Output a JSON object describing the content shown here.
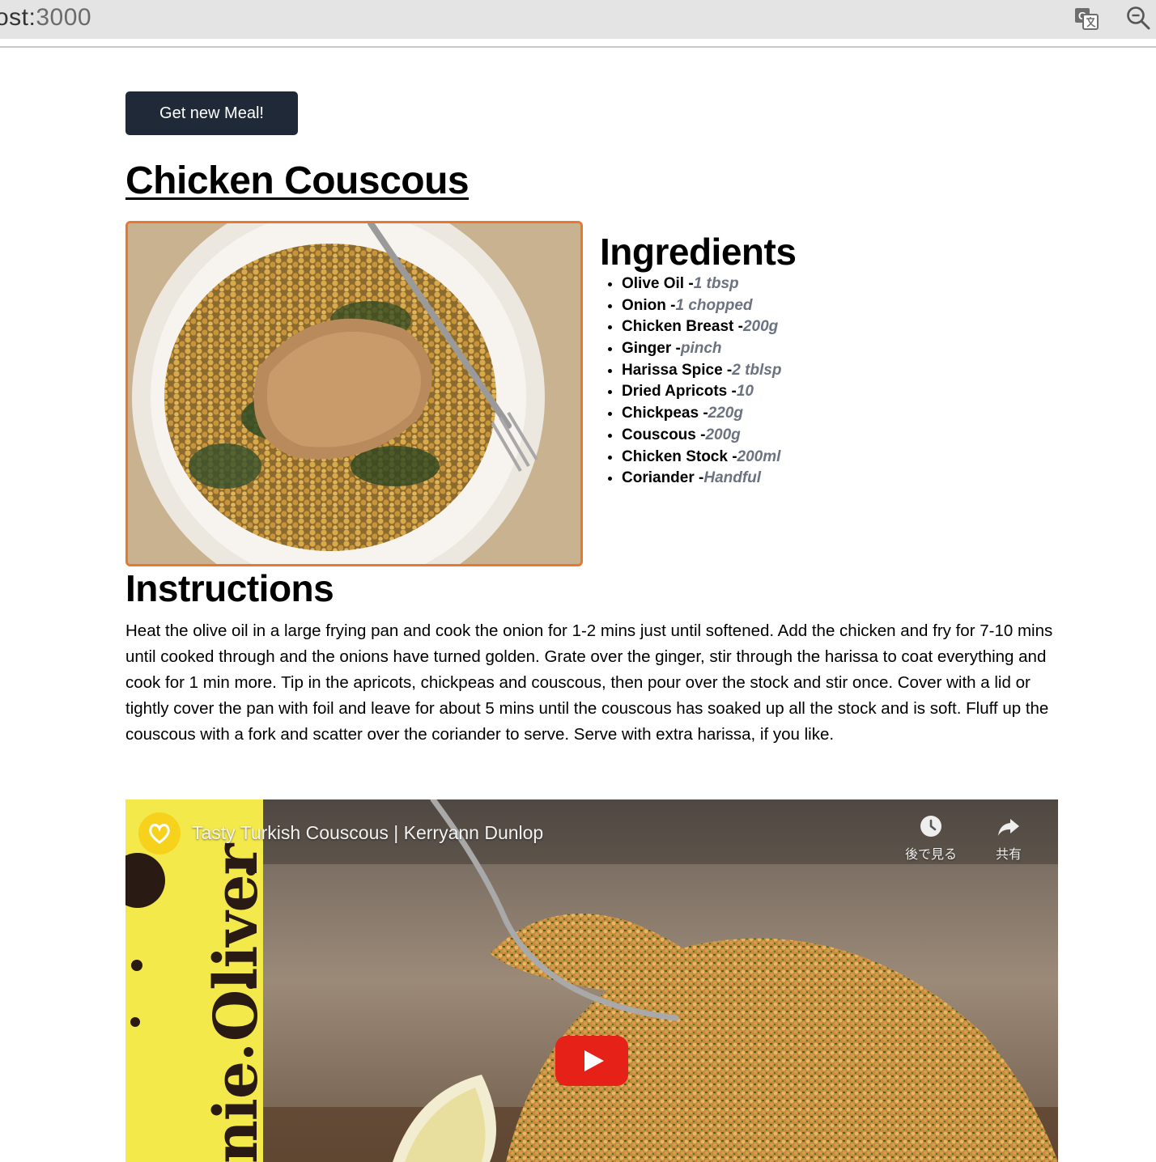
{
  "browser": {
    "url_host": "ost:",
    "url_port": "3000",
    "icons": [
      "translate-icon",
      "zoom-out-icon"
    ]
  },
  "actions": {
    "new_meal_label": "Get new Meal!"
  },
  "meal": {
    "title": "Chicken Couscous",
    "photo_icon": "meal-photo",
    "ingredients_heading": "Ingredients",
    "ingredients": [
      {
        "name": "Olive Oil -",
        "measure": "1 tbsp"
      },
      {
        "name": "Onion -",
        "measure": "1 chopped"
      },
      {
        "name": "Chicken Breast -",
        "measure": "200g"
      },
      {
        "name": "Ginger -",
        "measure": "pinch"
      },
      {
        "name": "Harissa Spice -",
        "measure": "2 tblsp"
      },
      {
        "name": "Dried Apricots -",
        "measure": "10"
      },
      {
        "name": "Chickpeas -",
        "measure": "220g"
      },
      {
        "name": "Couscous -",
        "measure": "200g"
      },
      {
        "name": "Chicken Stock -",
        "measure": "200ml"
      },
      {
        "name": "Coriander -",
        "measure": "Handful"
      }
    ],
    "instructions_heading": "Instructions",
    "instructions": "Heat the olive oil in a large frying pan and cook the onion for 1-2 mins just until softened. Add the chicken and fry for 7-10 mins until cooked through and the onions have turned golden. Grate over the ginger, stir through the harissa to coat everything and cook for 1 min more. Tip in the apricots, chickpeas and couscous, then pour over the stock and stir once. Cover with a lid or tightly cover the pan with foil and leave for about 5 mins until the couscous has soaked up all the stock and is soft. Fluff up the couscous with a fork and scatter over the coriander to serve. Serve with extra harissa, if you like."
  },
  "video": {
    "title": "Tasty Turkish Couscous | Kerryann Dunlop",
    "watch_later_label": "後で見る",
    "share_label": "共有",
    "banner_text": "nie Oliver",
    "colors": {
      "play": "#e62117",
      "avatar": "#f6d21d",
      "banner": "#f3e94a"
    }
  },
  "colors": {
    "button_bg": "#1f2937",
    "photo_border": "#e8782f",
    "measure_text": "#6b7280"
  }
}
